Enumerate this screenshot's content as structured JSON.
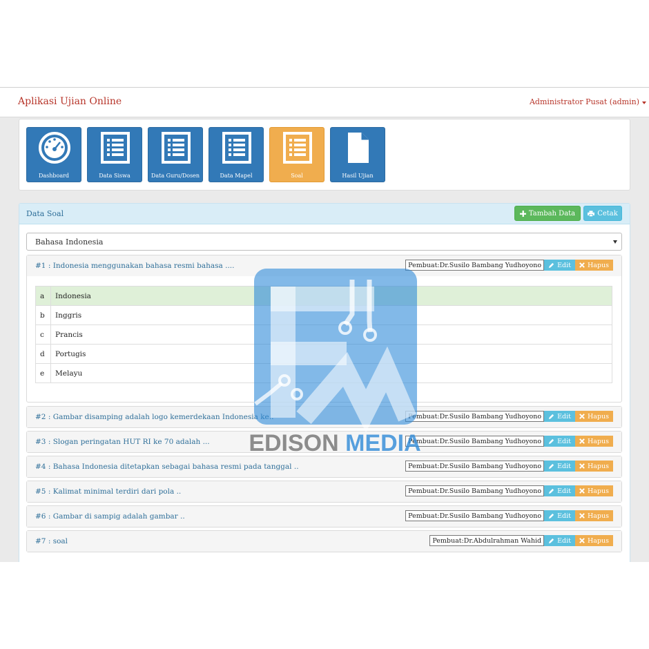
{
  "navbar": {
    "brand": "Aplikasi Ujian Online",
    "user": "Administrator Pusat (admin)"
  },
  "tiles": [
    {
      "label": "Dashboard",
      "icon": "dashboard-icon",
      "active": false
    },
    {
      "label": "Data Siswa",
      "icon": "list-icon",
      "active": false
    },
    {
      "label": "Data Guru/Dosen",
      "icon": "list-icon",
      "active": false
    },
    {
      "label": "Data Mapel",
      "icon": "list-icon",
      "active": false
    },
    {
      "label": "Soal",
      "icon": "list-icon",
      "active": true
    },
    {
      "label": "Hasil Ujian",
      "icon": "file-icon",
      "active": false
    }
  ],
  "panel": {
    "title": "Data Soal",
    "add_button": "Tambah Data",
    "print_button": "Cetak"
  },
  "filter": {
    "selected": "Bahasa Indonesia"
  },
  "questions": [
    {
      "text": "#1 : Indonesia menggunakan bahasa resmi bahasa ....",
      "author": "Pembuat:Dr.Susilo Bambang Yudhoyono",
      "edit": "Edit",
      "delete": "Hapus",
      "options": [
        {
          "letter": "a",
          "text": "Indonesia",
          "correct": true
        },
        {
          "letter": "b",
          "text": "Inggris",
          "correct": false
        },
        {
          "letter": "c",
          "text": "Prancis",
          "correct": false
        },
        {
          "letter": "d",
          "text": "Portugis",
          "correct": false
        },
        {
          "letter": "e",
          "text": "Melayu",
          "correct": false
        }
      ]
    },
    {
      "text": "#2 : Gambar disamping adalah logo kemerdekaan Indonesia ke..",
      "author": "Pembuat:Dr.Susilo Bambang Yudhoyono",
      "edit": "Edit",
      "delete": "Hapus"
    },
    {
      "text": "#3 : Slogan peringatan HUT RI ke 70 adalah ...",
      "author": "Pembuat:Dr.Susilo Bambang Yudhoyono",
      "edit": "Edit",
      "delete": "Hapus"
    },
    {
      "text": "#4 : Bahasa Indonesia ditetapkan sebagai bahasa resmi pada tanggal ..",
      "author": "Pembuat:Dr.Susilo Bambang Yudhoyono",
      "edit": "Edit",
      "delete": "Hapus"
    },
    {
      "text": "#5 : Kalimat minimal terdiri dari pola ..",
      "author": "Pembuat:Dr.Susilo Bambang Yudhoyono",
      "edit": "Edit",
      "delete": "Hapus"
    },
    {
      "text": "#6 : Gambar di sampig adalah gambar ..",
      "author": "Pembuat:Dr.Susilo Bambang Yudhoyono",
      "edit": "Edit",
      "delete": "Hapus"
    },
    {
      "text": "#7 : soal",
      "author": "Pembuat:Dr.Abdulrahman Wahid",
      "edit": "Edit",
      "delete": "Hapus"
    }
  ],
  "watermark": {
    "text": "EDISON MEDIA"
  },
  "colors": {
    "brand": "#b7352a",
    "tile_blue": "#3279b7",
    "tile_active": "#f0ad4e",
    "success": "#5cb85c",
    "info": "#5bc0de",
    "warning": "#f0ad4e",
    "correct_row": "#dff0d8"
  }
}
